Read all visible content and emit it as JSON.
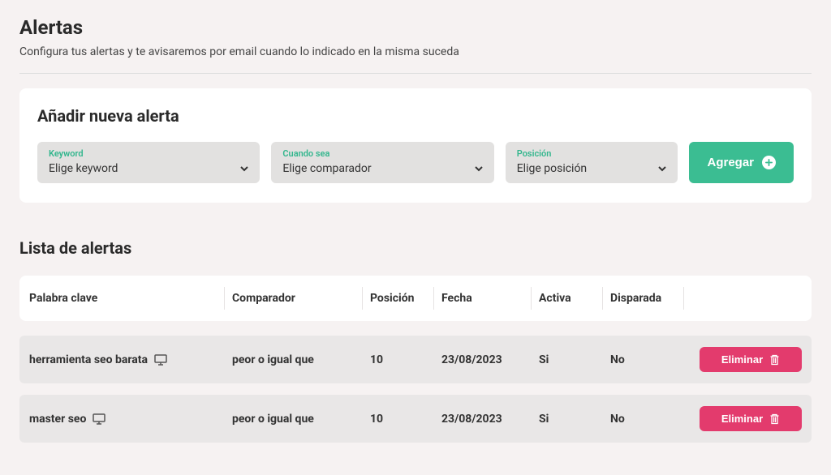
{
  "header": {
    "title": "Alertas",
    "subtitle": "Configura tus alertas y te avisaremos por email cuando lo indicado en la misma suceda"
  },
  "add_form": {
    "title": "Añadir nueva alerta",
    "fields": {
      "keyword": {
        "label": "Keyword",
        "value": "Elige keyword"
      },
      "compare": {
        "label": "Cuando sea",
        "value": "Elige comparador"
      },
      "position": {
        "label": "Posición",
        "value": "Elige posición"
      }
    },
    "submit_label": "Agregar"
  },
  "list": {
    "title": "Lista de alertas",
    "columns": {
      "keyword": "Palabra clave",
      "compare": "Comparador",
      "position": "Posición",
      "date": "Fecha",
      "active": "Activa",
      "fired": "Disparada"
    },
    "delete_label": "Eliminar",
    "rows": [
      {
        "keyword": "herramienta seo barata",
        "compare": "peor o igual que",
        "position": "10",
        "date": "23/08/2023",
        "active": "Si",
        "fired": "No"
      },
      {
        "keyword": "master seo",
        "compare": "peor o igual que",
        "position": "10",
        "date": "23/08/2023",
        "active": "Si",
        "fired": "No"
      }
    ]
  }
}
